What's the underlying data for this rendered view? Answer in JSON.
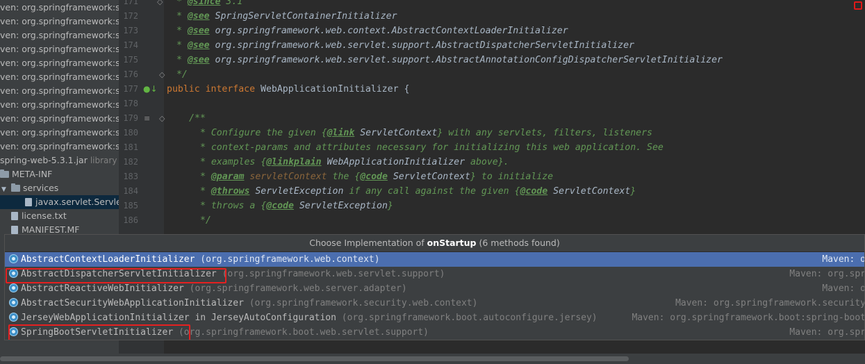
{
  "tree": {
    "rows": [
      {
        "text": "ven: org.springframework:spr"
      },
      {
        "text": "ven: org.springframework:spr"
      },
      {
        "text": "ven: org.springframework:spr"
      },
      {
        "text": "ven: org.springframework:spr"
      },
      {
        "text": "ven: org.springframework:spr"
      },
      {
        "text": "ven: org.springframework:spr"
      },
      {
        "text": "ven: org.springframework:spr"
      },
      {
        "text": "ven: org.springframework:spr"
      },
      {
        "text": "ven: org.springframework:spr"
      },
      {
        "text": "ven: org.springframework:spr"
      },
      {
        "text": "ven: org.springframework:spr"
      }
    ],
    "jar": {
      "name": "spring-web-5.3.1.jar",
      "suffix": "library ro"
    },
    "meta_inf": "META-INF",
    "services": "services",
    "service_file": "javax.servlet.ServletC",
    "license": "license.txt",
    "manifest": "MANIFEST.MF"
  },
  "gutter": {
    "line_numbers": [
      "171",
      "172",
      "173",
      "174",
      "175",
      "176",
      "177",
      "178",
      "179",
      "180",
      "181",
      "182",
      "183",
      "184",
      "185",
      "186"
    ]
  },
  "code": {
    "l171_tag": "@since",
    "l171_rest": " 3.1",
    "see": "@see",
    "l172_ref": "SpringServletContainerInitializer",
    "l173_ref": "org.springframework.web.context.AbstractContextLoaderInitializer",
    "l174_ref": "org.springframework.web.servlet.support.AbstractDispatcherServletInitializer",
    "l175_ref": "org.springframework.web.servlet.support.AbstractAnnotationConfigDispatcherServletInitializer",
    "l176": " */",
    "l177_kw1": "public",
    "l177_kw2": "interface",
    "l177_name": "WebApplicationInitializer {",
    "l179": "/**",
    "l180_a": " * Configure the given {",
    "l180_tag": "@link",
    "l180_ref": " ServletContext",
    "l180_b": "} with any servlets, filters, listeners",
    "l181": " * context-params and attributes necessary for initializing this web application. See",
    "l182_a": " * examples {",
    "l182_tag": "@linkplain",
    "l182_ref": " WebApplicationInitializer",
    "l182_b": " above}.",
    "l183_a": " * ",
    "l183_tag": "@param",
    "l183_p": " servletContext",
    "l183_b": " the {",
    "l183_tag2": "@code",
    "l183_ref": " ServletContext",
    "l183_c": "} to initialize",
    "l184_a": " * ",
    "l184_tag": "@throws",
    "l184_ref": " ServletException",
    "l184_b": " if any call against the given {",
    "l184_tag2": "@code",
    "l184_ref2": " ServletContext",
    "l184_c": "}",
    "l185_a": " * throws a {",
    "l185_tag": "@code",
    "l185_ref": " ServletException",
    "l185_b": "}",
    "l186": " */"
  },
  "popup": {
    "title_prefix": "Choose Implementation of ",
    "method": "onStartup",
    "title_suffix": " (6 methods found)",
    "items": [
      {
        "name": "AbstractContextLoaderInitializer",
        "pkg": "(org.springframework.web.context)",
        "source": "Maven: o"
      },
      {
        "name": "AbstractDispatcherServletInitializer",
        "pkg": "(org.springframework.web.servlet.support)",
        "source": "Maven: org.spr"
      },
      {
        "name": "AbstractReactiveWebInitializer",
        "pkg": "(org.springframework.web.server.adapter)",
        "source": "Maven: o"
      },
      {
        "name": "AbstractSecurityWebApplicationInitializer",
        "pkg": "(org.springframework.security.web.context)",
        "source": "Maven: org.springframework.security"
      },
      {
        "name": "JerseyWebApplicationInitializer in JerseyAutoConfiguration",
        "pkg": "(org.springframework.boot.autoconfigure.jersey)",
        "source": "Maven: org.springframework.boot:spring-boot"
      },
      {
        "name": "SpringBootServletInitializer",
        "pkg": "(org.springframework.boot.web.servlet.support)",
        "source": "Maven: org.spr"
      }
    ]
  },
  "colors": {
    "selection": "#4b6eaf",
    "highlight_box": "#e52020",
    "keyword": "#cc7832",
    "doc_comment": "#629755"
  }
}
